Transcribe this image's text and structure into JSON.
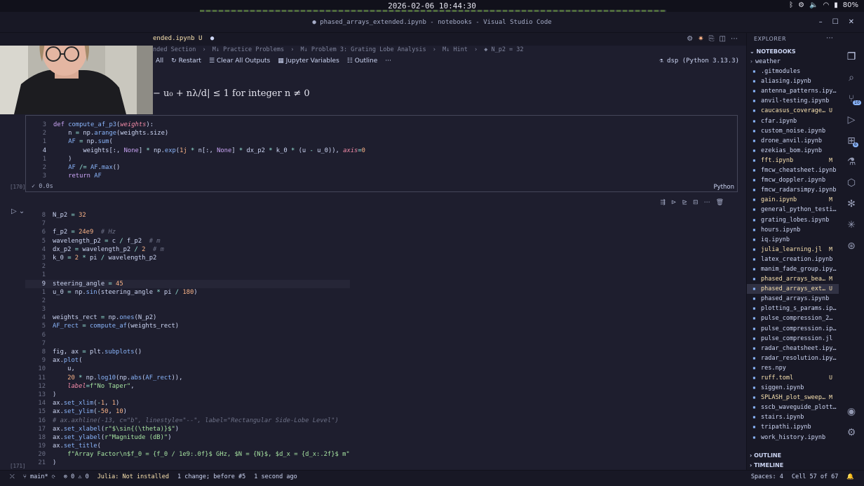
{
  "system": {
    "clock": "2026-02-06 10:44:30",
    "battery": "80%",
    "icons": [
      "bluetooth-icon",
      "settings-icon",
      "volume-icon",
      "wifi-icon",
      "battery-icon"
    ]
  },
  "window": {
    "title": "● phased_arrays_extended.ipynb - notebooks - Visual Studio Code"
  },
  "tab": {
    "label": "ended.ipynb",
    "status": "U"
  },
  "breadcrumb": [
    "nded Section",
    "›",
    "M↓ Practice Problems",
    "›",
    "M↓ Problem 3: Grating Lobe Analysis",
    "›",
    "M↓ Hint",
    "›",
    "◆ N_p2 = 32"
  ],
  "nb_toolbar": {
    "run_all": "All",
    "restart": "Restart",
    "clear_outputs": "Clear All Outputs",
    "variables": "Jupyter Variables",
    "outline": "Outline",
    "more": "···",
    "kernel": "dsp (Python 3.13.3)"
  },
  "markdown": {
    "formula": "− u₀ + nλ/d| ≤ 1 for integer n ≠ 0"
  },
  "cell1": {
    "exec_count": "[170]",
    "status_time": "0.0s",
    "language": "Python",
    "line_numbers": [
      "3",
      "2",
      "1",
      "4",
      "1",
      "2",
      "3"
    ]
  },
  "cell2": {
    "exec_count": "[171]",
    "line_numbers": [
      "8",
      "7",
      "6",
      "5",
      "4",
      "3",
      "2",
      "1",
      "9",
      "1",
      "2",
      "3",
      "4",
      "5",
      "6",
      "7",
      "8",
      "9",
      "10",
      "11",
      "12",
      "13",
      "14",
      "15",
      "16",
      "17",
      "18",
      "19",
      "20",
      "21"
    ]
  },
  "explorer": {
    "header": "EXPLORER",
    "section": "NOTEBOOKS",
    "outline": "OUTLINE",
    "timeline": "TIMELINE",
    "files": [
      {
        "name": "weather",
        "kind": "folder",
        "badge": ""
      },
      {
        "name": ".gitmodules",
        "kind": "file",
        "badge": ""
      },
      {
        "name": "aliasing.ipynb",
        "kind": "file",
        "badge": ""
      },
      {
        "name": "antenna_patterns.ipy…",
        "kind": "file",
        "badge": ""
      },
      {
        "name": "anvil-testing.ipynb",
        "kind": "file",
        "badge": ""
      },
      {
        "name": "caucasus_coverage…",
        "kind": "untracked",
        "badge": "U"
      },
      {
        "name": "cfar.ipynb",
        "kind": "file",
        "badge": ""
      },
      {
        "name": "custom_noise.ipynb",
        "kind": "file",
        "badge": ""
      },
      {
        "name": "drone_anvil.ipynb",
        "kind": "file",
        "badge": ""
      },
      {
        "name": "ezekias_bom.ipynb",
        "kind": "file",
        "badge": ""
      },
      {
        "name": "fft.ipynb",
        "kind": "mod",
        "badge": "M"
      },
      {
        "name": "fmcw_cheatsheet.ipynb",
        "kind": "file",
        "badge": ""
      },
      {
        "name": "fmcw_doppler.ipynb",
        "kind": "file",
        "badge": ""
      },
      {
        "name": "fmcw_radarsimpy.ipynb",
        "kind": "file",
        "badge": ""
      },
      {
        "name": "gain.ipynb",
        "kind": "mod",
        "badge": "M"
      },
      {
        "name": "general_python_testi…",
        "kind": "file",
        "badge": ""
      },
      {
        "name": "grating_lobes.ipynb",
        "kind": "file",
        "badge": ""
      },
      {
        "name": "hours.ipynb",
        "kind": "file",
        "badge": ""
      },
      {
        "name": "iq.ipynb",
        "kind": "file",
        "badge": ""
      },
      {
        "name": "julia_learning.jl",
        "kind": "mod",
        "badge": "M"
      },
      {
        "name": "latex_creation.ipynb",
        "kind": "file",
        "badge": ""
      },
      {
        "name": "manim_fade_group.ipy…",
        "kind": "file",
        "badge": ""
      },
      {
        "name": "phased_arrays_bea…",
        "kind": "mod",
        "badge": "M"
      },
      {
        "name": "phased_arrays_ext…",
        "kind": "sel",
        "badge": "U"
      },
      {
        "name": "phased_arrays.ipynb",
        "kind": "file",
        "badge": ""
      },
      {
        "name": "plotting_s_params.ip…",
        "kind": "file",
        "badge": ""
      },
      {
        "name": "pulse_compression_2…",
        "kind": "file",
        "badge": ""
      },
      {
        "name": "pulse_compression.ip…",
        "kind": "file",
        "badge": ""
      },
      {
        "name": "pulse_compression.jl",
        "kind": "file",
        "badge": ""
      },
      {
        "name": "radar_cheatsheet.ipy…",
        "kind": "file",
        "badge": ""
      },
      {
        "name": "radar_resolution.ipy…",
        "kind": "file",
        "badge": ""
      },
      {
        "name": "res.npy",
        "kind": "file",
        "badge": ""
      },
      {
        "name": "ruff.toml",
        "kind": "untracked",
        "badge": "U"
      },
      {
        "name": "siggen.ipynb",
        "kind": "file",
        "badge": ""
      },
      {
        "name": "SPLASH_plot_sweep…",
        "kind": "mod",
        "badge": "M"
      },
      {
        "name": "sscb_waveguide_plott…",
        "kind": "file",
        "badge": ""
      },
      {
        "name": "stairs.ipynb",
        "kind": "file",
        "badge": ""
      },
      {
        "name": "tripathi.ipynb",
        "kind": "file",
        "badge": ""
      },
      {
        "name": "work_history.ipynb",
        "kind": "file",
        "badge": ""
      }
    ]
  },
  "activity": {
    "source_control_badge": "10",
    "extensions_badge": "6"
  },
  "statusbar": {
    "branch": "main*",
    "sync": "⟳",
    "errors": "⊗ 0 ⚠ 0",
    "julia": "Julia: Not installed",
    "changes": "1 change; before #5",
    "saved": "1 second ago",
    "spaces": "Spaces: 4",
    "cell": "Cell 57 of 67"
  },
  "colors": {
    "background": "#1e1e2e",
    "sidebar": "#181825",
    "accent": "#89b4fa",
    "modified": "#f9e2af",
    "success": "#a6e3a1"
  }
}
